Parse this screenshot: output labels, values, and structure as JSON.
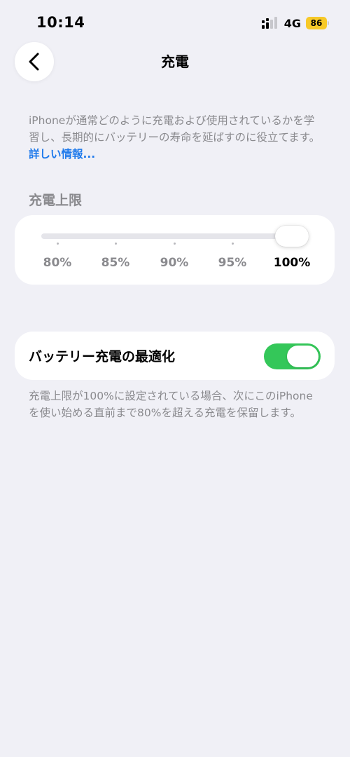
{
  "status_bar": {
    "time": "10:14",
    "network": "4G",
    "battery_level": "86",
    "battery_color": "#f7c928",
    "icons": [
      "cellular-signal-icon",
      "battery-icon"
    ]
  },
  "nav": {
    "back_icon": "chevron-left-icon",
    "title": "充電"
  },
  "description": {
    "text": "iPhoneが通常どのように充電および使用されているかを学習し、長期的にバッテリーの寿命を延ばすのに役立てます。",
    "link_label": "詳しい情報...",
    "link_color": "#1f7aeb"
  },
  "charge_limit": {
    "header": "充電上限",
    "options": [
      "80%",
      "85%",
      "90%",
      "95%",
      "100%"
    ],
    "selected": "100%",
    "selected_fraction": 1.0
  },
  "optimized_charging": {
    "label": "バッテリー充電の最適化",
    "enabled": true,
    "on_color": "#34c759",
    "note": "充電上限が100%に設定されている場合、次にこのiPhoneを使い始める直前まで80%を超える充電を保留します。"
  }
}
